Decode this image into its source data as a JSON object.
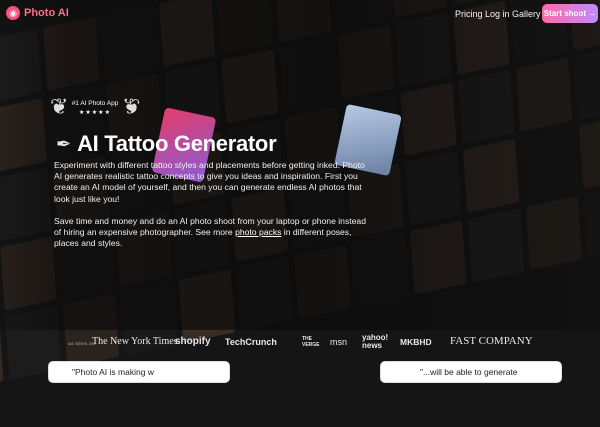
{
  "nav": {
    "brand": "Photo AI",
    "links": [
      "Pricing",
      "Log in",
      "Gallery"
    ],
    "cta": "Start shoot →"
  },
  "badge": {
    "title": "#1 AI Photo App",
    "stars": "★★★★★",
    "rating": 5
  },
  "hero": {
    "title": "AI Tattoo Generator",
    "paragraph1": "Experiment with different tattoo styles and placements before getting inked. Photo AI generates realistic tattoo concepts to give you ideas and inspiration. First you create an AI model of yourself, and then you can generate endless AI photos that look just like you!",
    "paragraph2_before": "Save time and money and do an AI photo shoot from your laptop or phone instead of hiring an expensive photographer. See more ",
    "paragraph2_link": "photo packs",
    "paragraph2_after": " in different poses, places and styles."
  },
  "press": {
    "label": "AS SEEN ON",
    "logos": [
      "The New York Times",
      "shopify",
      "TechCrunch",
      "THE VERGE",
      "msn",
      "yahoo! news",
      "MKBHD",
      "FAST COMPANY"
    ]
  },
  "quotes": [
    "\"Photo AI is making w",
    "\"...will be able to generate"
  ]
}
